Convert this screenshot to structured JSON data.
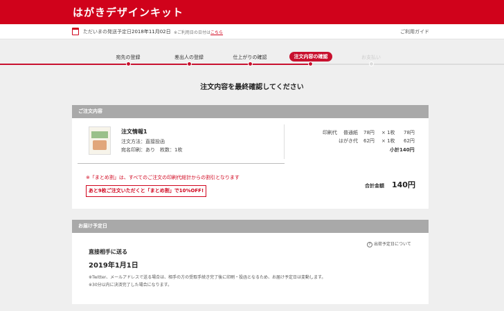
{
  "header": {
    "title": "はがきデザインキット"
  },
  "subbar": {
    "label": "ただいまの発送予定日",
    "date": "2018年11月02日",
    "note": "※ご利用日の日付は",
    "note_link": "こちら",
    "guide": "ご利用ガイド"
  },
  "steps": [
    {
      "label": "宛先の登録",
      "state": "done"
    },
    {
      "label": "差出人の登録",
      "state": "done"
    },
    {
      "label": "仕上がりの確認",
      "state": "done"
    },
    {
      "label": "注文内容の確認",
      "state": "active"
    },
    {
      "label": "お支払い",
      "state": "disabled"
    }
  ],
  "main": {
    "title": "注文内容を最終確認してください"
  },
  "order": {
    "section_title": "ご注文内容",
    "item_title": "注文情報1",
    "method": "注文方法：直接投函",
    "options": "宛名印刷：あり　枚数：1枚",
    "prices": [
      {
        "label": "印刷代",
        "type": "普通紙",
        "unit": "78円",
        "qty": "× 1枚",
        "amount": "78円"
      },
      {
        "label": "はがき代",
        "type": "",
        "unit": "62円",
        "qty": "× 1枚",
        "amount": "62円"
      }
    ],
    "subtotal": "小計140円",
    "note": "※「まとめ割」は、すべてのご注文の印刷代総計からの割引となります",
    "discount_button": "あと9枚ご注文いただくと「まとめ割」で10%OFF!",
    "total_label": "合計金額",
    "total_value": "140円"
  },
  "shipping": {
    "section_title": "お届け予定日",
    "recipient_title": "直接相手に送る",
    "date": "2019年1月1日",
    "help": "出荷予定日について",
    "help_icon": "?",
    "notes": [
      "※Twitter、メールアドレスで送る場合は、相手の方の受取手続き完了後に印刷・投函となるため、お届け予定日は変動します。",
      "※30分以内に決済完了した場合になります。"
    ]
  },
  "colors": {
    "brand": "#d0021b",
    "section_header": "#a9a9a9"
  }
}
